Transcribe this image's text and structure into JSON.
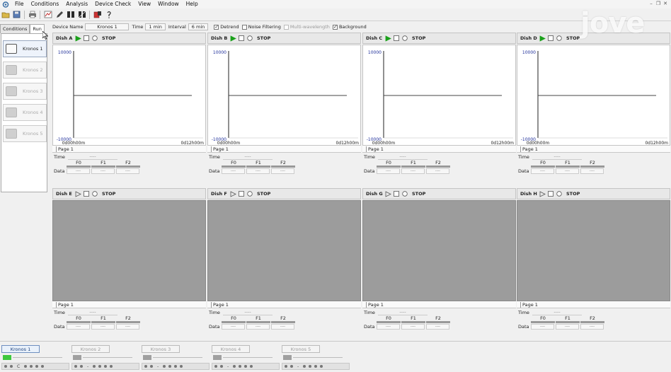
{
  "menu": [
    "File",
    "Conditions",
    "Analysis",
    "Device Check",
    "View",
    "Window",
    "Help"
  ],
  "left_tabs": [
    "Conditions",
    "Run"
  ],
  "devices": [
    {
      "label": "Kronos 1",
      "active": true
    },
    {
      "label": "Kronos 2",
      "active": false
    },
    {
      "label": "Kronos 3",
      "active": false
    },
    {
      "label": "Kronos 4",
      "active": false
    },
    {
      "label": "Kronos 5",
      "active": false
    }
  ],
  "settings": {
    "device_name_label": "Device Name",
    "device_name_value": "Kronos 1",
    "time_label": "Time",
    "time_value": "1 min",
    "interval_label": "Interval",
    "interval_value": "6 min",
    "detrend_label": "Detrend",
    "detrend_checked": true,
    "noise_label": "Noise Filtering",
    "noise_checked": false,
    "multi_label": "Multi-wavelength",
    "multi_checked": false,
    "background_label": "Background",
    "background_checked": true
  },
  "dishes": [
    {
      "name": "Dish A",
      "active": true,
      "stop_label": "STOP",
      "y_top": "10000",
      "y_bottom": "-10000",
      "x_start": "0d00h00m",
      "x_end": "0d12h00m",
      "page": "Page 1",
      "time_label": "Time",
      "time_value": "-----",
      "filters": [
        "F0",
        "F1",
        "F2"
      ],
      "f0_progress": 1.0,
      "data_label": "Data",
      "data_values": [
        "----",
        "----",
        "----"
      ]
    },
    {
      "name": "Dish B",
      "active": true,
      "stop_label": "STOP",
      "y_top": "10000",
      "y_bottom": "-10000",
      "x_start": "0d00h00m",
      "x_end": "0d12h00m",
      "page": "Page 1",
      "time_label": "Time",
      "time_value": "-----",
      "filters": [
        "F0",
        "F1",
        "F2"
      ],
      "f0_progress": 1.0,
      "data_label": "Data",
      "data_values": [
        "----",
        "----",
        "----"
      ]
    },
    {
      "name": "Dish C",
      "active": true,
      "stop_label": "STOP",
      "y_top": "10000",
      "y_bottom": "-10000",
      "x_start": "0d00h00m",
      "x_end": "0d12h00m",
      "page": "Page 1",
      "time_label": "Time",
      "time_value": "-----",
      "filters": [
        "F0",
        "F1",
        "F2"
      ],
      "f0_progress": 1.0,
      "data_label": "Data",
      "data_values": [
        "----",
        "----",
        "----"
      ]
    },
    {
      "name": "Dish D",
      "active": true,
      "stop_label": "STOP",
      "y_top": "10000",
      "y_bottom": "-10000",
      "x_start": "0d00h00m",
      "x_end": "0d12h00m",
      "page": "Page 1",
      "time_label": "Time",
      "time_value": "-----",
      "filters": [
        "F0",
        "F1",
        "F2"
      ],
      "f0_progress": 1.0,
      "data_label": "Data",
      "data_values": [
        "----",
        "----",
        "----"
      ]
    },
    {
      "name": "Dish E",
      "active": false,
      "stop_label": "STOP",
      "page": "Page 1",
      "time_label": "Time",
      "time_value": "-----",
      "filters": [
        "F0",
        "F1",
        "F2"
      ],
      "f0_progress": 0,
      "data_label": "Data",
      "data_values": [
        "----",
        "----",
        "----"
      ]
    },
    {
      "name": "Dish F",
      "active": false,
      "stop_label": "STOP",
      "page": "Page 1",
      "time_label": "Time",
      "time_value": "-----",
      "filters": [
        "F0",
        "F1",
        "F2"
      ],
      "f0_progress": 0,
      "data_label": "Data",
      "data_values": [
        "----",
        "----",
        "----"
      ]
    },
    {
      "name": "Dish G",
      "active": false,
      "stop_label": "STOP",
      "page": "Page 1",
      "time_label": "Time",
      "time_value": "-----",
      "filters": [
        "F0",
        "F1",
        "F2"
      ],
      "f0_progress": 0,
      "data_label": "Data",
      "data_values": [
        "----",
        "----",
        "----"
      ]
    },
    {
      "name": "Dish H",
      "active": false,
      "stop_label": "STOP",
      "page": "Page 1",
      "time_label": "Time",
      "time_value": "-----",
      "filters": [
        "F0",
        "F1",
        "F2"
      ],
      "f0_progress": 0,
      "data_label": "Data",
      "data_values": [
        "----",
        "----",
        "----"
      ]
    }
  ],
  "bottom_tabs": [
    {
      "label": "Kronos 1",
      "active": true
    },
    {
      "label": "Kronos 2",
      "active": false
    },
    {
      "label": "Kronos 3",
      "active": false
    },
    {
      "label": "Kronos 4",
      "active": false
    },
    {
      "label": "Kronos 5",
      "active": false
    }
  ],
  "bottom_strip_symbols": [
    "C",
    "-",
    "-",
    "-",
    "-"
  ],
  "watermark": "jove",
  "colors": {
    "play_active": "#1aa01a",
    "progress_red": "#d42020",
    "meter_green": "#3ec83e",
    "inactive_plot": "#9c9c9c"
  }
}
